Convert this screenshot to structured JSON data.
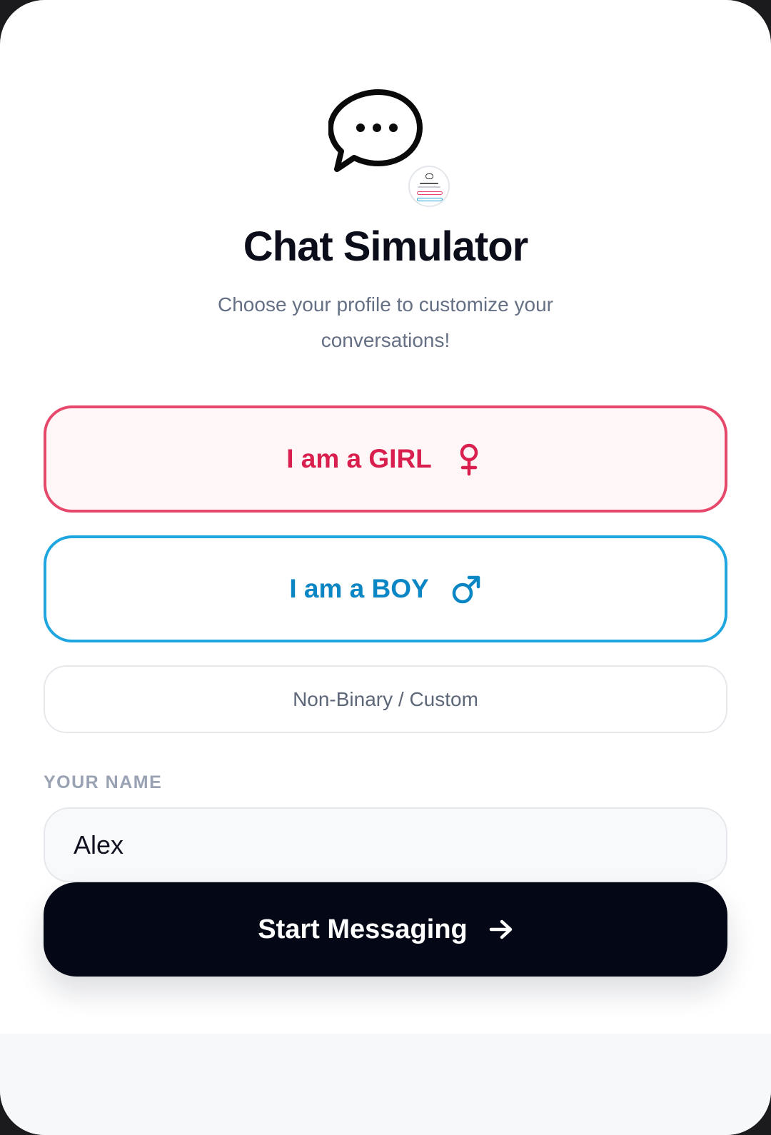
{
  "app": {
    "title": "Chat Simulator",
    "subtitle": "Choose your profile to customize your conversations!"
  },
  "options": {
    "girl_label": "I am a GIRL",
    "boy_label": "I am a BOY",
    "nonbinary_label": "Non-Binary / Custom"
  },
  "name_field": {
    "label": "YOUR NAME",
    "value": "Alex"
  },
  "start_button": {
    "label": "Start Messaging"
  },
  "icons": {
    "logo": "chat-bubble-dots-icon",
    "girl": "female-symbol-icon",
    "boy": "male-symbol-icon",
    "start": "arrow-right-icon"
  },
  "colors": {
    "girl_accent": "#e5486a",
    "girl_text": "#d81f4d",
    "boy_accent": "#1ea6e0",
    "boy_text": "#0a86c4",
    "primary_button": "#040716",
    "muted_text": "#667085"
  }
}
